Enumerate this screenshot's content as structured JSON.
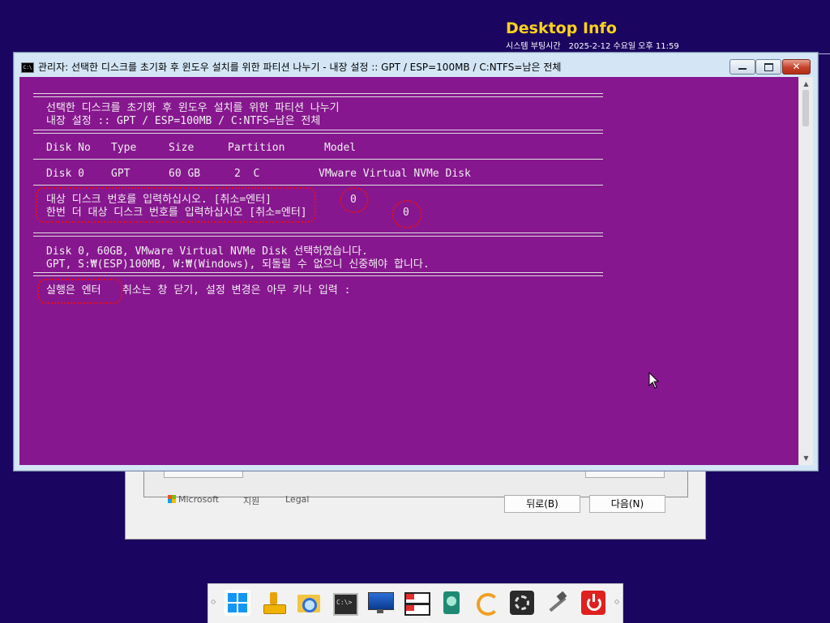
{
  "desktop_info": {
    "title": "Desktop Info",
    "boot_label": "시스템 부팅시간",
    "boot_value": "2025-2-12 수요일 오후 11:59"
  },
  "background_window": {
    "brand": "Microsoft",
    "support": "지원",
    "legal": "Legal",
    "back_button": "뒤로(B)",
    "next_button": "다음(N)"
  },
  "console": {
    "title": "관리자:  선택한 디스크를 초기화 후 윈도우 설치를 위한 파티션 나누기 - 내장 설정 :: GPT / ESP=100MB / C:NTFS=남은 전체",
    "icon_label": "C:\\",
    "heading1": "선택한 디스크를 초기화 후 윈도우 설치를 위한 파티션 나누기",
    "heading2": "내장 설정 :: GPT / ESP=100MB / C:NTFS=남은 전체",
    "columns": [
      "Disk No",
      "Type",
      "Size",
      "Partition",
      "Model"
    ],
    "disk_row": [
      "Disk 0",
      "GPT",
      "60 GB",
      "2  C",
      "VMware Virtual NVMe Disk"
    ],
    "prompt1_label": "대상 디스크 번호를 입력하십시오. [취소=엔터]",
    "prompt1_value": "0",
    "prompt2_label": "한번 더 대상 디스크 번호를 입력하십시오 [취소=엔터]",
    "prompt2_value": "0",
    "confirm1": "Disk 0, 60GB, VMware Virtual NVMe Disk 선택하였습니다.",
    "confirm2": "GPT, S:₩(ESP)100MB, W:₩(Windows), 되돌릴 수 없으니 신중해야 합니다.",
    "exec_enter": "실행은 엔터",
    "exec_rest": " 취소는 창 닫기, 설정 변경은 아무 키나 입력 :",
    "colors": {
      "background": "#87178f",
      "text": "#f0f0f0",
      "highlight": "#e3101b"
    }
  },
  "taskbar": {
    "icons": [
      "windows-start-icon",
      "usb-drive-icon",
      "folder-search-icon",
      "command-prompt-icon",
      "monitor-icon",
      "disk-partition-icon",
      "disk-tool-icon",
      "sync-icon",
      "settings-gear-icon",
      "tools-icon",
      "power-icon"
    ]
  }
}
